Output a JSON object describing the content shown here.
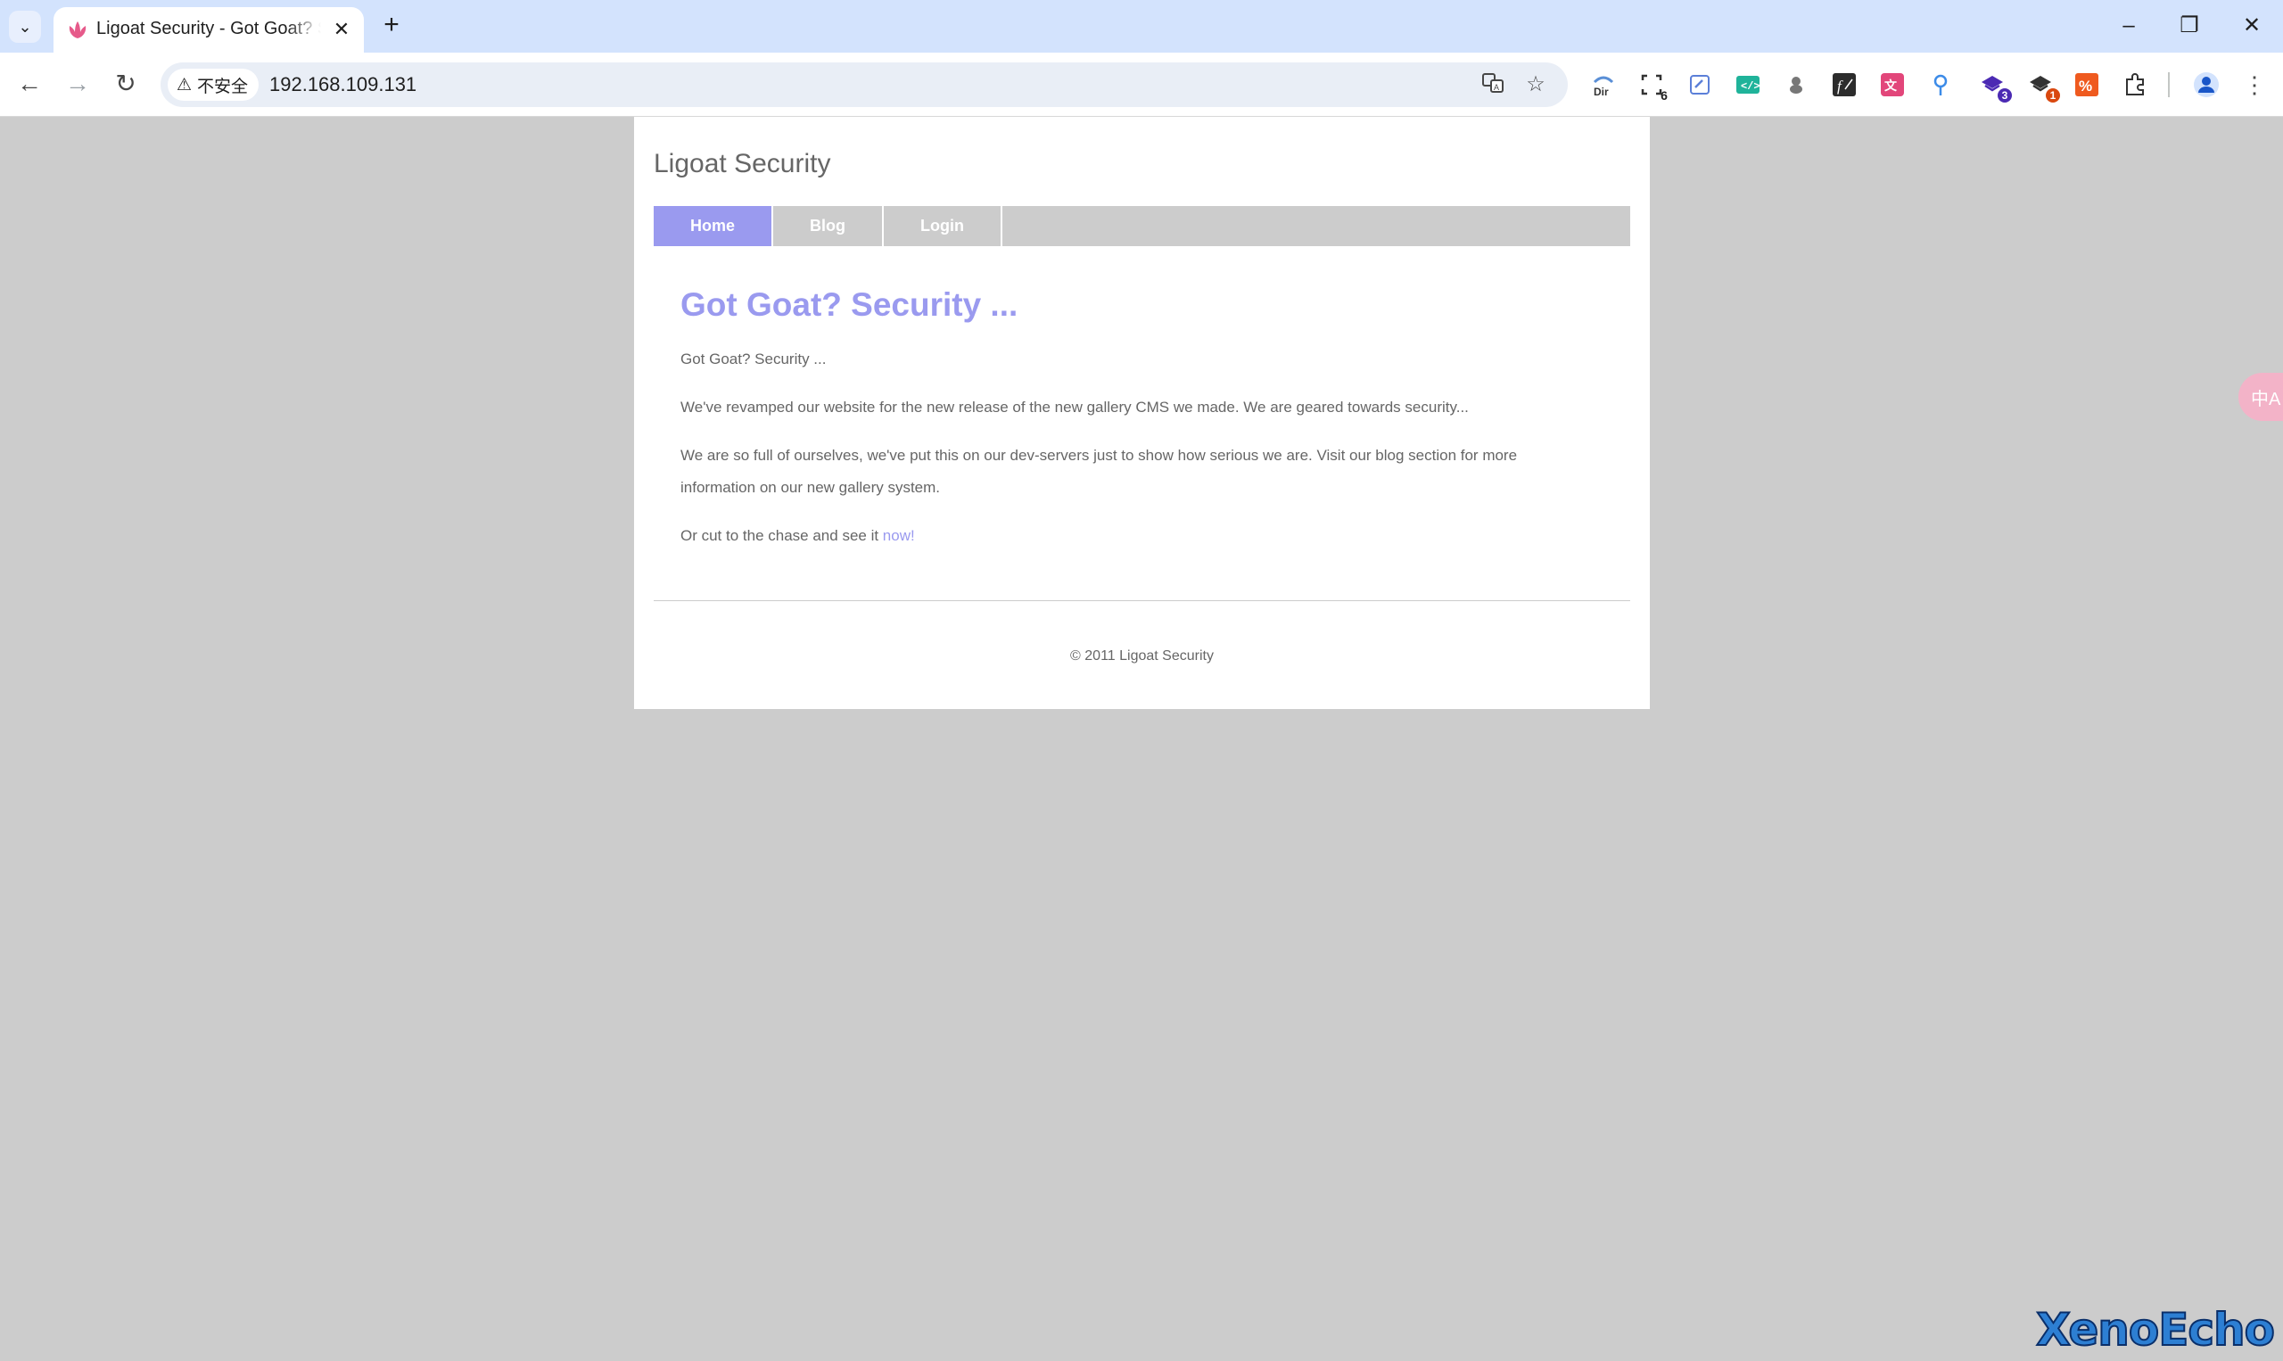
{
  "browser": {
    "tab": {
      "title": "Ligoat Security - Got Goat? Security ..."
    },
    "new_tab_label": "+",
    "address": {
      "security_label": "不安全",
      "url": "192.168.109.131"
    },
    "extensions": [
      {
        "name": "dir-extension-icon",
        "label": "Dir",
        "badge": ""
      },
      {
        "name": "scan-extension-icon",
        "label": "",
        "badge": "6"
      },
      {
        "name": "link-extension-icon",
        "label": "",
        "badge": ""
      },
      {
        "name": "code-extension-icon",
        "label": "",
        "badge": ""
      },
      {
        "name": "bug-extension-icon",
        "label": "",
        "badge": ""
      },
      {
        "name": "function-extension-icon",
        "label": "",
        "badge": ""
      },
      {
        "name": "translate-extension-icon",
        "label": "",
        "badge": ""
      },
      {
        "name": "location-extension-icon",
        "label": "",
        "badge": ""
      },
      {
        "name": "wappalyzer-extension-icon",
        "label": "",
        "badge": "3"
      },
      {
        "name": "cookie-extension-icon",
        "label": "",
        "badge": "1"
      },
      {
        "name": "percent-extension-icon",
        "label": "",
        "badge": ""
      }
    ],
    "colors": {
      "tabbar": "#d3e3fd",
      "omnibox": "#e9eef6"
    }
  },
  "site": {
    "title": "Ligoat Security",
    "nav": [
      {
        "label": "Home",
        "active": true
      },
      {
        "label": "Blog",
        "active": false
      },
      {
        "label": "Login",
        "active": false
      }
    ],
    "headline": "Got Goat? Security ...",
    "paragraphs": {
      "p1": "Got Goat? Security ...",
      "p2": "We've revamped our website for the new release of the new gallery CMS we made. We are geared towards security...",
      "p3": "We are so full of ourselves, we've put this on our dev-servers just to show how serious we are. Visit our blog section for more information on our new gallery system.",
      "p4_prefix": "Or cut to the chase and see it ",
      "p4_link": "now!"
    },
    "footer": "© 2011 Ligoat Security",
    "colors": {
      "accent": "#9a9aef",
      "text": "#666666",
      "nav_bg": "#cccccc",
      "page_bg": "#cccccc"
    }
  },
  "side_translate_label": "中A",
  "watermark": "XenoEcho"
}
